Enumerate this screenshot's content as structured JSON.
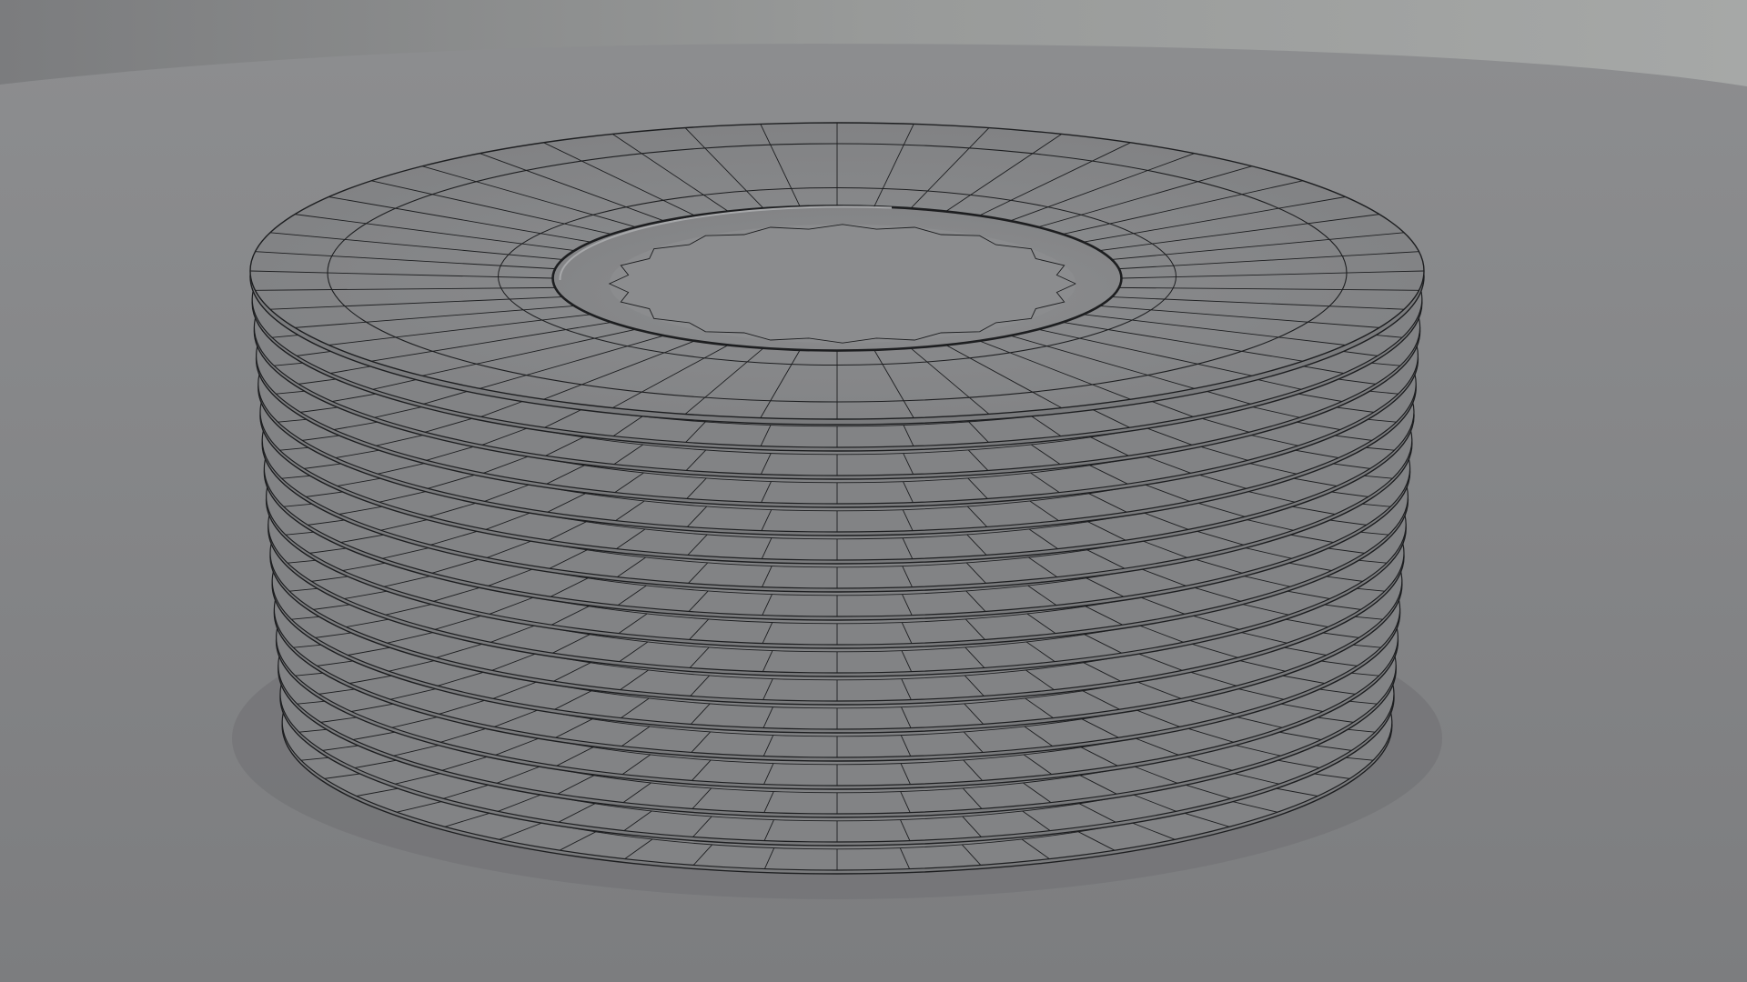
{
  "scene": {
    "subject": "stack-of-plates",
    "render_style": "grey clay wireframe",
    "plate_count": 17,
    "radial_segments": 48,
    "colors": {
      "floor": "#7f8082",
      "floor_shadow": "#6f7072",
      "background_top": "#959697",
      "background_sky": "#a3a5a4",
      "plate_face": "#828385",
      "plate_rim": "#7a7b7d",
      "plate_well": "#8b8c8e",
      "wire": "#1d1e20",
      "highlight": "#a7a8aa"
    }
  }
}
